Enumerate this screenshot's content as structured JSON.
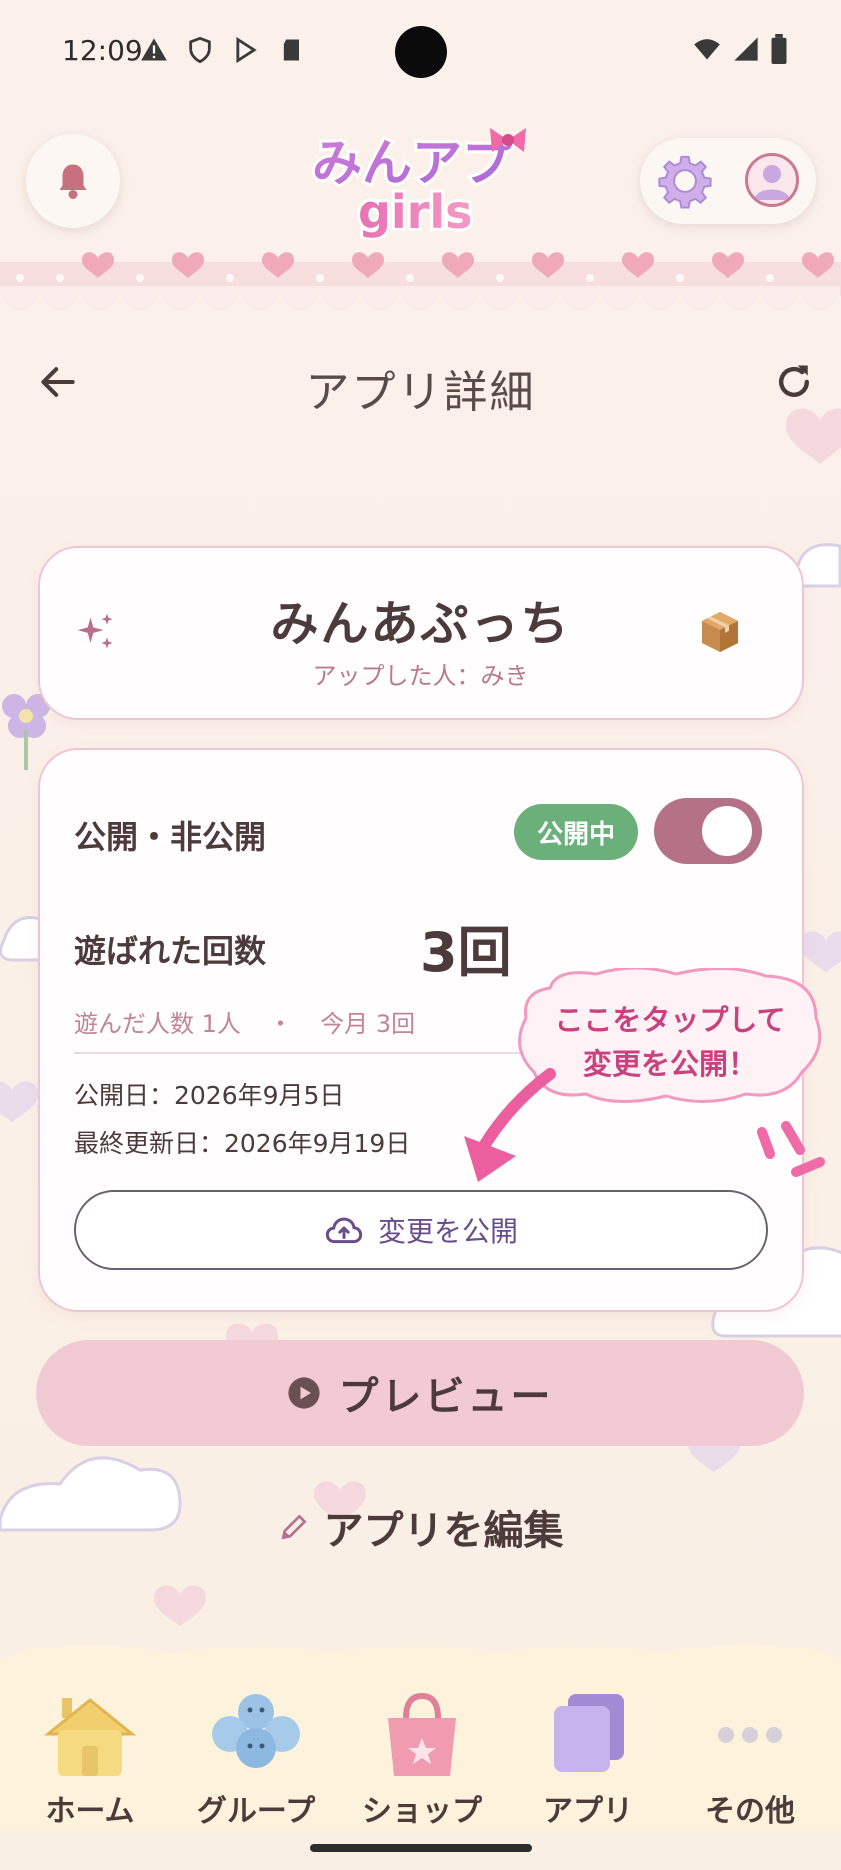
{
  "status_bar": {
    "time": "12:09"
  },
  "header": {
    "logo_text_top": "みんアプ",
    "logo_text_bottom": "girls"
  },
  "page": {
    "title": "アプリ詳細"
  },
  "app_card": {
    "name": "みんあぷっち",
    "uploader": "アップした人：みき"
  },
  "stats_card": {
    "visibility_label": "公開・非公開",
    "status_badge": "公開中",
    "toggle_on": true,
    "plays_label": "遊ばれた回数",
    "plays_count": "3回",
    "players": "遊んだ人数 1人",
    "separator": "・",
    "this_month": "今月 3回",
    "published_date": "公開日：2026年9月5日",
    "updated_date": "最終更新日：2026年9月19日",
    "publish_button": "変更を公開"
  },
  "tooltip": {
    "line1": "ここをタップして",
    "line2": "変更を公開！"
  },
  "actions": {
    "preview": "プレビュー",
    "edit": "アプリを編集"
  },
  "bottom_nav": {
    "items": [
      {
        "label": "ホーム",
        "icon": "house-icon"
      },
      {
        "label": "グループ",
        "icon": "group-icon"
      },
      {
        "label": "ショップ",
        "icon": "shopping-bag-icon"
      },
      {
        "label": "アプリ",
        "icon": "app-cards-icon"
      },
      {
        "label": "その他",
        "icon": "more-dots-icon"
      }
    ]
  },
  "colors": {
    "accent_pink": "#c8437e",
    "toggle_on": "#b57286",
    "badge_green": "#6bb07a",
    "preview_bg": "#f1cad3"
  }
}
